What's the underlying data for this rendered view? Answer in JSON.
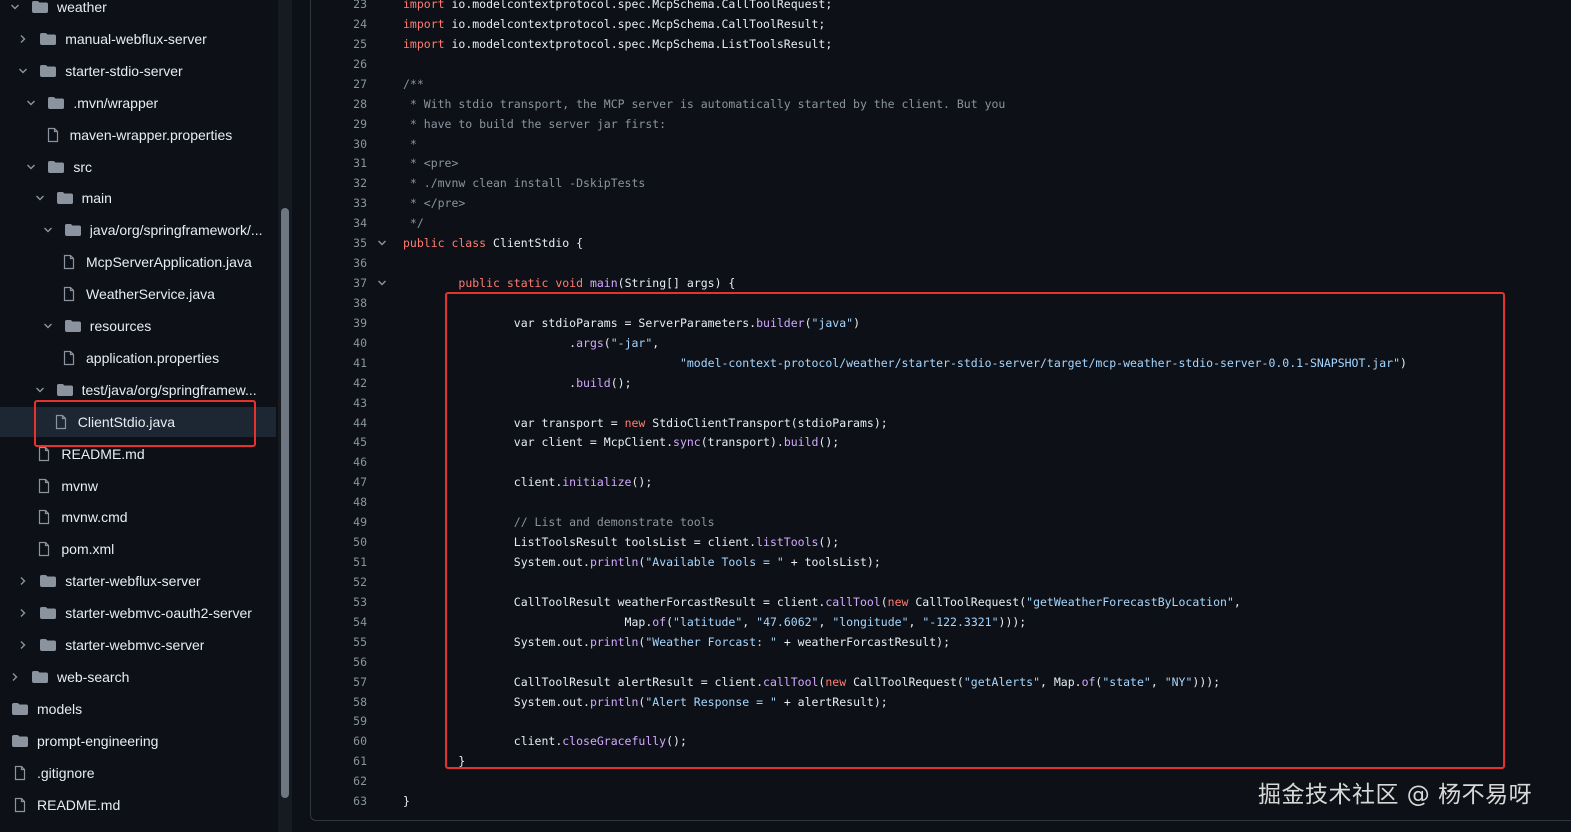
{
  "file_tree": [
    {
      "label": "weather",
      "type": "folder",
      "expanded": true,
      "depth": 0
    },
    {
      "label": "manual-webflux-server",
      "type": "folder",
      "expanded": false,
      "depth": 1
    },
    {
      "label": "starter-stdio-server",
      "type": "folder",
      "expanded": true,
      "depth": 1
    },
    {
      "label": ".mvn/wrapper",
      "type": "folder",
      "expanded": true,
      "depth": 2
    },
    {
      "label": "maven-wrapper.properties",
      "type": "file",
      "depth": 3
    },
    {
      "label": "src",
      "type": "folder",
      "expanded": true,
      "depth": 2
    },
    {
      "label": "main",
      "type": "folder",
      "expanded": true,
      "depth": 3
    },
    {
      "label": "java/org/springframework/...",
      "type": "folder",
      "expanded": true,
      "depth": 4
    },
    {
      "label": "McpServerApplication.java",
      "type": "file",
      "depth": 5
    },
    {
      "label": "WeatherService.java",
      "type": "file",
      "depth": 5
    },
    {
      "label": "resources",
      "type": "folder",
      "expanded": true,
      "depth": 4
    },
    {
      "label": "application.properties",
      "type": "file",
      "depth": 5
    },
    {
      "label": "test/java/org/springframew...",
      "type": "folder",
      "expanded": true,
      "depth": 3
    },
    {
      "label": "ClientStdio.java",
      "type": "file",
      "depth": 4,
      "selected": true
    },
    {
      "label": "README.md",
      "type": "file",
      "depth": 2
    },
    {
      "label": "mvnw",
      "type": "file",
      "depth": 2
    },
    {
      "label": "mvnw.cmd",
      "type": "file",
      "depth": 2
    },
    {
      "label": "pom.xml",
      "type": "file",
      "depth": 2
    },
    {
      "label": "starter-webflux-server",
      "type": "folder",
      "expanded": false,
      "depth": 1
    },
    {
      "label": "starter-webmvc-oauth2-server",
      "type": "folder",
      "expanded": false,
      "depth": 1
    },
    {
      "label": "starter-webmvc-server",
      "type": "folder",
      "expanded": false,
      "depth": 1
    },
    {
      "label": "web-search",
      "type": "folder",
      "expanded": false,
      "depth": 0
    },
    {
      "label": "models",
      "type": "folder",
      "depth": 0,
      "no_chevron": true
    },
    {
      "label": "prompt-engineering",
      "type": "folder",
      "depth": 0,
      "no_chevron": true
    },
    {
      "label": ".gitignore",
      "type": "file",
      "depth": 0
    },
    {
      "label": "README.md",
      "type": "file",
      "depth": 0
    }
  ],
  "code_lines": [
    {
      "n": "23",
      "fold": false,
      "tokens": [
        [
          "k",
          "import"
        ],
        [
          "t",
          " io.modelcontextprotocol.spec.McpSchema.CallToolRequest;"
        ]
      ]
    },
    {
      "n": "24",
      "fold": false,
      "tokens": [
        [
          "k",
          "import"
        ],
        [
          "t",
          " io.modelcontextprotocol.spec.McpSchema.CallToolResult;"
        ]
      ]
    },
    {
      "n": "25",
      "fold": false,
      "tokens": [
        [
          "k",
          "import"
        ],
        [
          "t",
          " io.modelcontextprotocol.spec.McpSchema.ListToolsResult;"
        ]
      ]
    },
    {
      "n": "26",
      "fold": false,
      "tokens": []
    },
    {
      "n": "27",
      "fold": false,
      "tokens": [
        [
          "c",
          "/**"
        ]
      ]
    },
    {
      "n": "28",
      "fold": false,
      "tokens": [
        [
          "c",
          " * With stdio transport, the MCP server is automatically started by the client. But you"
        ]
      ]
    },
    {
      "n": "29",
      "fold": false,
      "tokens": [
        [
          "c",
          " * have to build the server jar first:"
        ]
      ]
    },
    {
      "n": "30",
      "fold": false,
      "tokens": [
        [
          "c",
          " *"
        ]
      ]
    },
    {
      "n": "31",
      "fold": false,
      "tokens": [
        [
          "c",
          " * <pre>"
        ]
      ]
    },
    {
      "n": "32",
      "fold": false,
      "tokens": [
        [
          "c",
          " * ./mvnw clean install -DskipTests"
        ]
      ]
    },
    {
      "n": "33",
      "fold": false,
      "tokens": [
        [
          "c",
          " * </pre>"
        ]
      ]
    },
    {
      "n": "34",
      "fold": false,
      "tokens": [
        [
          "c",
          " */"
        ]
      ]
    },
    {
      "n": "35",
      "fold": true,
      "tokens": [
        [
          "k",
          "public class"
        ],
        [
          "t",
          " ClientStdio {"
        ]
      ]
    },
    {
      "n": "36",
      "fold": false,
      "tokens": []
    },
    {
      "n": "37",
      "fold": true,
      "tokens": [
        [
          "t",
          "        "
        ],
        [
          "k",
          "public static void"
        ],
        [
          "t",
          " "
        ],
        [
          "f",
          "main"
        ],
        [
          "t",
          "(String[] args) {"
        ]
      ]
    },
    {
      "n": "38",
      "fold": false,
      "tokens": []
    },
    {
      "n": "39",
      "fold": false,
      "tokens": [
        [
          "t",
          "                var stdioParams = ServerParameters."
        ],
        [
          "f",
          "builder"
        ],
        [
          "t",
          "("
        ],
        [
          "s",
          "\"java\""
        ],
        [
          "t",
          ")"
        ]
      ]
    },
    {
      "n": "40",
      "fold": false,
      "tokens": [
        [
          "t",
          "                        ."
        ],
        [
          "f",
          "args"
        ],
        [
          "t",
          "("
        ],
        [
          "s",
          "\"-jar\""
        ],
        [
          "t",
          ","
        ]
      ]
    },
    {
      "n": "41",
      "fold": false,
      "tokens": [
        [
          "t",
          "                                        "
        ],
        [
          "s",
          "\"model-context-protocol/weather/starter-stdio-server/target/mcp-weather-stdio-server-0.0.1-SNAPSHOT.jar\""
        ],
        [
          "t",
          ")"
        ]
      ]
    },
    {
      "n": "42",
      "fold": false,
      "tokens": [
        [
          "t",
          "                        ."
        ],
        [
          "f",
          "build"
        ],
        [
          "t",
          "();"
        ]
      ]
    },
    {
      "n": "43",
      "fold": false,
      "tokens": []
    },
    {
      "n": "44",
      "fold": false,
      "tokens": [
        [
          "t",
          "                var transport = "
        ],
        [
          "k",
          "new"
        ],
        [
          "t",
          " StdioClientTransport(stdioParams);"
        ]
      ]
    },
    {
      "n": "45",
      "fold": false,
      "tokens": [
        [
          "t",
          "                var client = McpClient."
        ],
        [
          "f",
          "sync"
        ],
        [
          "t",
          "(transport)."
        ],
        [
          "f",
          "build"
        ],
        [
          "t",
          "();"
        ]
      ]
    },
    {
      "n": "46",
      "fold": false,
      "tokens": []
    },
    {
      "n": "47",
      "fold": false,
      "tokens": [
        [
          "t",
          "                client."
        ],
        [
          "f",
          "initialize"
        ],
        [
          "t",
          "();"
        ]
      ]
    },
    {
      "n": "48",
      "fold": false,
      "tokens": []
    },
    {
      "n": "49",
      "fold": false,
      "tokens": [
        [
          "t",
          "                "
        ],
        [
          "c",
          "// List and demonstrate tools"
        ]
      ]
    },
    {
      "n": "50",
      "fold": false,
      "tokens": [
        [
          "t",
          "                ListToolsResult toolsList = client."
        ],
        [
          "f",
          "listTools"
        ],
        [
          "t",
          "();"
        ]
      ]
    },
    {
      "n": "51",
      "fold": false,
      "tokens": [
        [
          "t",
          "                System.out."
        ],
        [
          "f",
          "println"
        ],
        [
          "t",
          "("
        ],
        [
          "s",
          "\"Available Tools = \""
        ],
        [
          "t",
          " + toolsList);"
        ]
      ]
    },
    {
      "n": "52",
      "fold": false,
      "tokens": []
    },
    {
      "n": "53",
      "fold": false,
      "tokens": [
        [
          "t",
          "                CallToolResult weatherForcastResult = client."
        ],
        [
          "f",
          "callTool"
        ],
        [
          "t",
          "("
        ],
        [
          "k",
          "new"
        ],
        [
          "t",
          " CallToolRequest("
        ],
        [
          "s",
          "\"getWeatherForecastByLocation\""
        ],
        [
          "t",
          ","
        ]
      ]
    },
    {
      "n": "54",
      "fold": false,
      "tokens": [
        [
          "t",
          "                                Map."
        ],
        [
          "f",
          "of"
        ],
        [
          "t",
          "("
        ],
        [
          "s",
          "\"latitude\""
        ],
        [
          "t",
          ", "
        ],
        [
          "s",
          "\"47.6062\""
        ],
        [
          "t",
          ", "
        ],
        [
          "s",
          "\"longitude\""
        ],
        [
          "t",
          ", "
        ],
        [
          "s",
          "\"-122.3321\""
        ],
        [
          "t",
          ")));"
        ]
      ]
    },
    {
      "n": "55",
      "fold": false,
      "tokens": [
        [
          "t",
          "                System.out."
        ],
        [
          "f",
          "println"
        ],
        [
          "t",
          "("
        ],
        [
          "s",
          "\"Weather Forcast: \""
        ],
        [
          "t",
          " + weatherForcastResult);"
        ]
      ]
    },
    {
      "n": "56",
      "fold": false,
      "tokens": []
    },
    {
      "n": "57",
      "fold": false,
      "tokens": [
        [
          "t",
          "                CallToolResult alertResult = client."
        ],
        [
          "f",
          "callTool"
        ],
        [
          "t",
          "("
        ],
        [
          "k",
          "new"
        ],
        [
          "t",
          " CallToolRequest("
        ],
        [
          "s",
          "\"getAlerts\""
        ],
        [
          "t",
          ", Map."
        ],
        [
          "f",
          "of"
        ],
        [
          "t",
          "("
        ],
        [
          "s",
          "\"state\""
        ],
        [
          "t",
          ", "
        ],
        [
          "s",
          "\"NY\""
        ],
        [
          "t",
          ")));"
        ]
      ]
    },
    {
      "n": "58",
      "fold": false,
      "tokens": [
        [
          "t",
          "                System.out."
        ],
        [
          "f",
          "println"
        ],
        [
          "t",
          "("
        ],
        [
          "s",
          "\"Alert Response = \""
        ],
        [
          "t",
          " + alertResult);"
        ]
      ]
    },
    {
      "n": "59",
      "fold": false,
      "tokens": []
    },
    {
      "n": "60",
      "fold": false,
      "tokens": [
        [
          "t",
          "                client."
        ],
        [
          "f",
          "closeGracefully"
        ],
        [
          "t",
          "();"
        ]
      ]
    },
    {
      "n": "61",
      "fold": false,
      "tokens": [
        [
          "t",
          "        }"
        ]
      ]
    },
    {
      "n": "62",
      "fold": false,
      "tokens": []
    },
    {
      "n": "63",
      "fold": false,
      "tokens": [
        [
          "t",
          "}"
        ]
      ]
    }
  ],
  "watermark": "掘金技术社区 @ 杨不易呀",
  "colors": {
    "background": "#0d1117",
    "selected_row": "#1d2633",
    "highlight_box": "#e5322d",
    "keyword": "#ff7b72",
    "string": "#a5d6ff",
    "comment": "#8b949e",
    "function": "#d2a8ff"
  }
}
